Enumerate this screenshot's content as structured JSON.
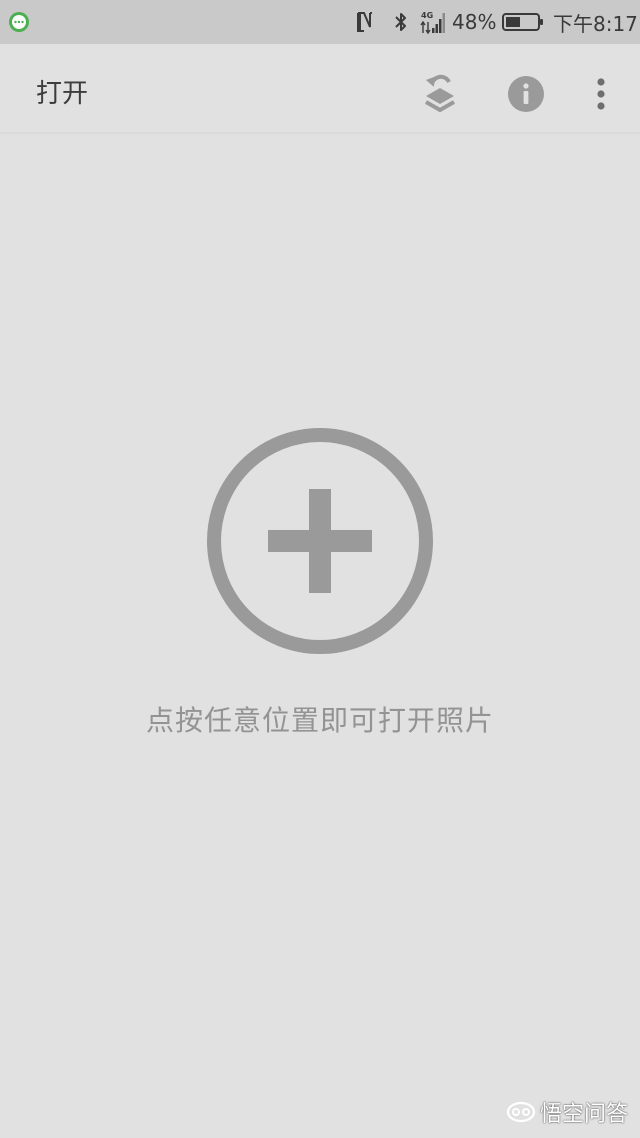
{
  "status_bar": {
    "battery_percent": "48%",
    "battery_level": 0.48,
    "network": "4G",
    "time": "下午8:17"
  },
  "app_bar": {
    "title": "打开",
    "actions": [
      "layers-swap-icon",
      "info-icon",
      "more-vert-icon"
    ]
  },
  "main": {
    "hint": "点按任意位置即可打开照片",
    "add_icon": "add-circle-icon"
  },
  "watermark": {
    "text": "悟空问答"
  },
  "colors": {
    "status_bar_bg": "#c9c9c9",
    "app_bg": "#e1e1e1",
    "icon_gray": "#9a9a9a",
    "hint_gray": "#939393",
    "title_text": "#3d3d3d",
    "notification_green": "#4caf50"
  }
}
